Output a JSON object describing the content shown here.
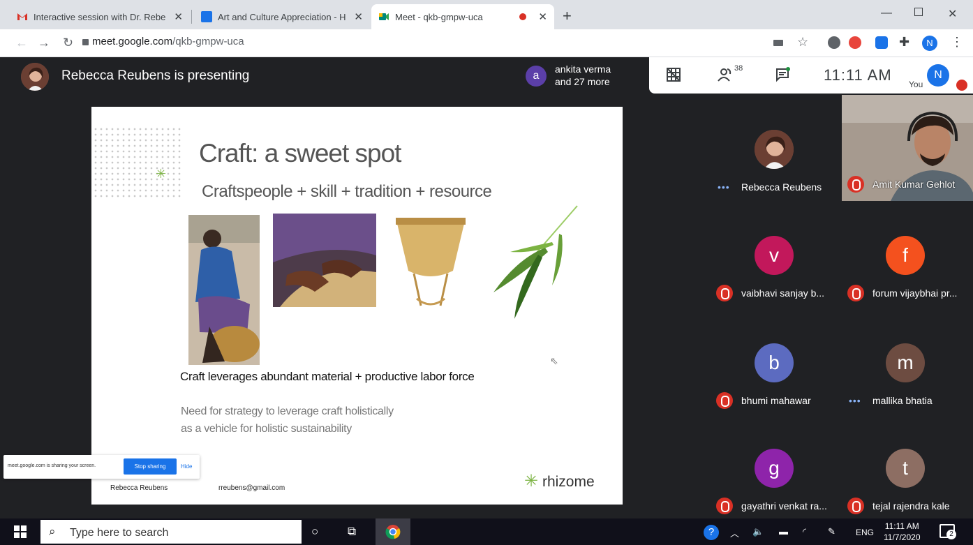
{
  "browser": {
    "tabs": [
      {
        "title": "Interactive session with Dr. Rebe",
        "favicon": "gmail-icon",
        "active": false
      },
      {
        "title": "Art and Culture Appreciation - H",
        "favicon": "classroom-icon",
        "active": false
      },
      {
        "title": "Meet - qkb-gmpw-uca",
        "favicon": "meet-icon",
        "active": true
      }
    ],
    "url_host": "meet.google.com",
    "url_path": "/qkb-gmpw-uca",
    "profile_initial": "N"
  },
  "meet": {
    "presenter_text": "Rebecca Reubens is presenting",
    "viewer_initial": "a",
    "viewer_line1": "ankita verma",
    "viewer_line2": "and 27 more",
    "participant_count": "38",
    "clock": "11:11 AM",
    "you_label": "You",
    "you_initial": "N"
  },
  "slide": {
    "title": "Craft: a sweet spot",
    "subtitle": "Craftspeople + skill + tradition + resource",
    "statement": "Craft leverages abundant material +  productive labor force",
    "need_line1": "Need for strategy to leverage craft holistically",
    "need_line2": "as a vehicle for holistic sustainability",
    "author": "Rebecca Reubens",
    "email": "rreubens@gmail.com",
    "brand": "rhizome"
  },
  "share_banner": {
    "text": "meet.google.com is sharing your screen.",
    "stop_label": "Stop sharing",
    "hide_label": "Hide"
  },
  "participants": [
    {
      "name": "Rebecca Reubens",
      "initial": "",
      "color": "#8d5a4a",
      "muted": false,
      "speaking": true
    },
    {
      "name": "Amit Kumar Gehlot",
      "initial": "",
      "color": "#9a8e84",
      "muted": true,
      "speaking": false
    },
    {
      "name": "vaibhavi sanjay b...",
      "initial": "v",
      "color": "#c2185b",
      "muted": true,
      "speaking": false
    },
    {
      "name": "forum vijaybhai pr...",
      "initial": "f",
      "color": "#f4511e",
      "muted": true,
      "speaking": false
    },
    {
      "name": "bhumi mahawar",
      "initial": "b",
      "color": "#5c6bc0",
      "muted": true,
      "speaking": false
    },
    {
      "name": "mallika bhatia",
      "initial": "m",
      "color": "#6d4c41",
      "muted": false,
      "speaking": true
    },
    {
      "name": "gayathri venkat ra...",
      "initial": "g",
      "color": "#8e24aa",
      "muted": true,
      "speaking": false
    },
    {
      "name": "tejal rajendra kale",
      "initial": "t",
      "color": "#8d6e63",
      "muted": true,
      "speaking": false
    }
  ],
  "taskbar": {
    "search_placeholder": "Type here to search",
    "lang": "ENG",
    "time": "11:11 AM",
    "date": "11/7/2020",
    "notification_count": "2"
  }
}
